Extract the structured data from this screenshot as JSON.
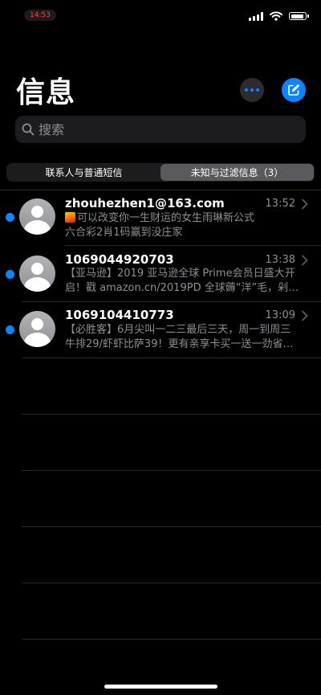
{
  "status": {
    "time": "14:53"
  },
  "header": {
    "title": "信息"
  },
  "search": {
    "placeholder": "搜索"
  },
  "segments": [
    {
      "label": "联系人与普通短信",
      "active": false
    },
    {
      "label": "未知与过滤信息（3）",
      "active": true
    }
  ],
  "messages": [
    {
      "sender": "zhouhezhen1@163.com",
      "time": "13:52",
      "unread": true,
      "preview_line1": "可以改变你一生财运的女生雨琳新公式",
      "preview_line2": "六合彩2肖1码赢到没庄家",
      "emoji_icon": "fire-emoji-icon"
    },
    {
      "sender": "1069044920703",
      "time": "13:38",
      "unread": true,
      "preview_line1": "【亚马逊】2019 亚马逊全球 Prime会员日盛大开",
      "preview_line2": "启！戳 amazon.cn/2019PD 全球薅“洋”毛，剁…"
    },
    {
      "sender": "1069104410773",
      "time": "13:09",
      "unread": true,
      "preview_line1": "【必胜客】6月尖叫一二三最后三天，周一到周三",
      "preview_line2": "牛排29/虾虾比萨39！更有亲享卡买一送一劲省…"
    }
  ],
  "colors": {
    "accent": "#0a84ff",
    "background": "#000000",
    "secondary_text": "#8e8e93"
  }
}
